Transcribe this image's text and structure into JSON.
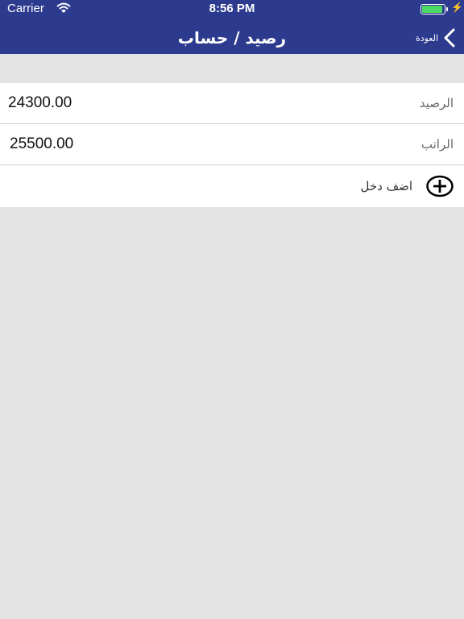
{
  "status_bar": {
    "carrier": "Carrier",
    "time": "8:56 PM",
    "battery_level": 0.92,
    "battery_color": "#4cd964"
  },
  "nav": {
    "title": "رصيد / حساب",
    "back_label": "العودة",
    "back_icon": "chevron-left-icon",
    "bar_color": "#2d3b8f"
  },
  "rows": [
    {
      "label": "الرصيد",
      "value": "24300.00"
    },
    {
      "label": "الراتب",
      "value": "25500.00"
    }
  ],
  "add_row": {
    "label": "اضف دخل",
    "icon": "plus-circle-icon"
  }
}
